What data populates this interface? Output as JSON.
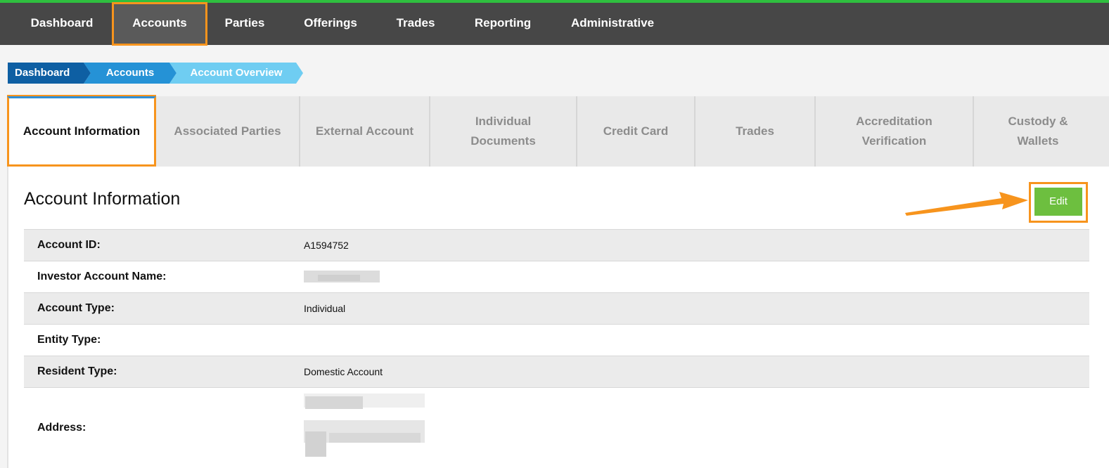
{
  "nav": {
    "items": [
      "Dashboard",
      "Accounts",
      "Parties",
      "Offerings",
      "Trades",
      "Reporting",
      "Administrative"
    ],
    "active": "Accounts"
  },
  "breadcrumb": [
    "Dashboard",
    "Accounts",
    "Account Overview"
  ],
  "tabs": [
    {
      "label": "Account Information",
      "active": true
    },
    {
      "label": "Associated Parties"
    },
    {
      "label": "External Account"
    },
    {
      "label": "Individual Documents"
    },
    {
      "label": "Credit Card"
    },
    {
      "label": "Trades"
    },
    {
      "label": "Accreditation Verification"
    },
    {
      "label": "Custody & Wallets"
    }
  ],
  "panel": {
    "title": "Account Information",
    "edit_label": "Edit"
  },
  "fields": [
    {
      "key": "Account ID:",
      "value": "A1594752"
    },
    {
      "key": "Investor Account Name:",
      "value": ""
    },
    {
      "key": "Account Type:",
      "value": "Individual"
    },
    {
      "key": "Entity Type:",
      "value": ""
    },
    {
      "key": "Resident Type:",
      "value": "Domestic Account"
    },
    {
      "key": "Address:",
      "value": ""
    }
  ],
  "colors": {
    "nav_bg": "#474747",
    "nav_top_border": "#2fbf3f",
    "highlight": "#f7941d",
    "crumb_1": "#0e5fa3",
    "crumb_2": "#2592d6",
    "crumb_3": "#6fcdf2",
    "edit_button": "#6dbf3f"
  }
}
